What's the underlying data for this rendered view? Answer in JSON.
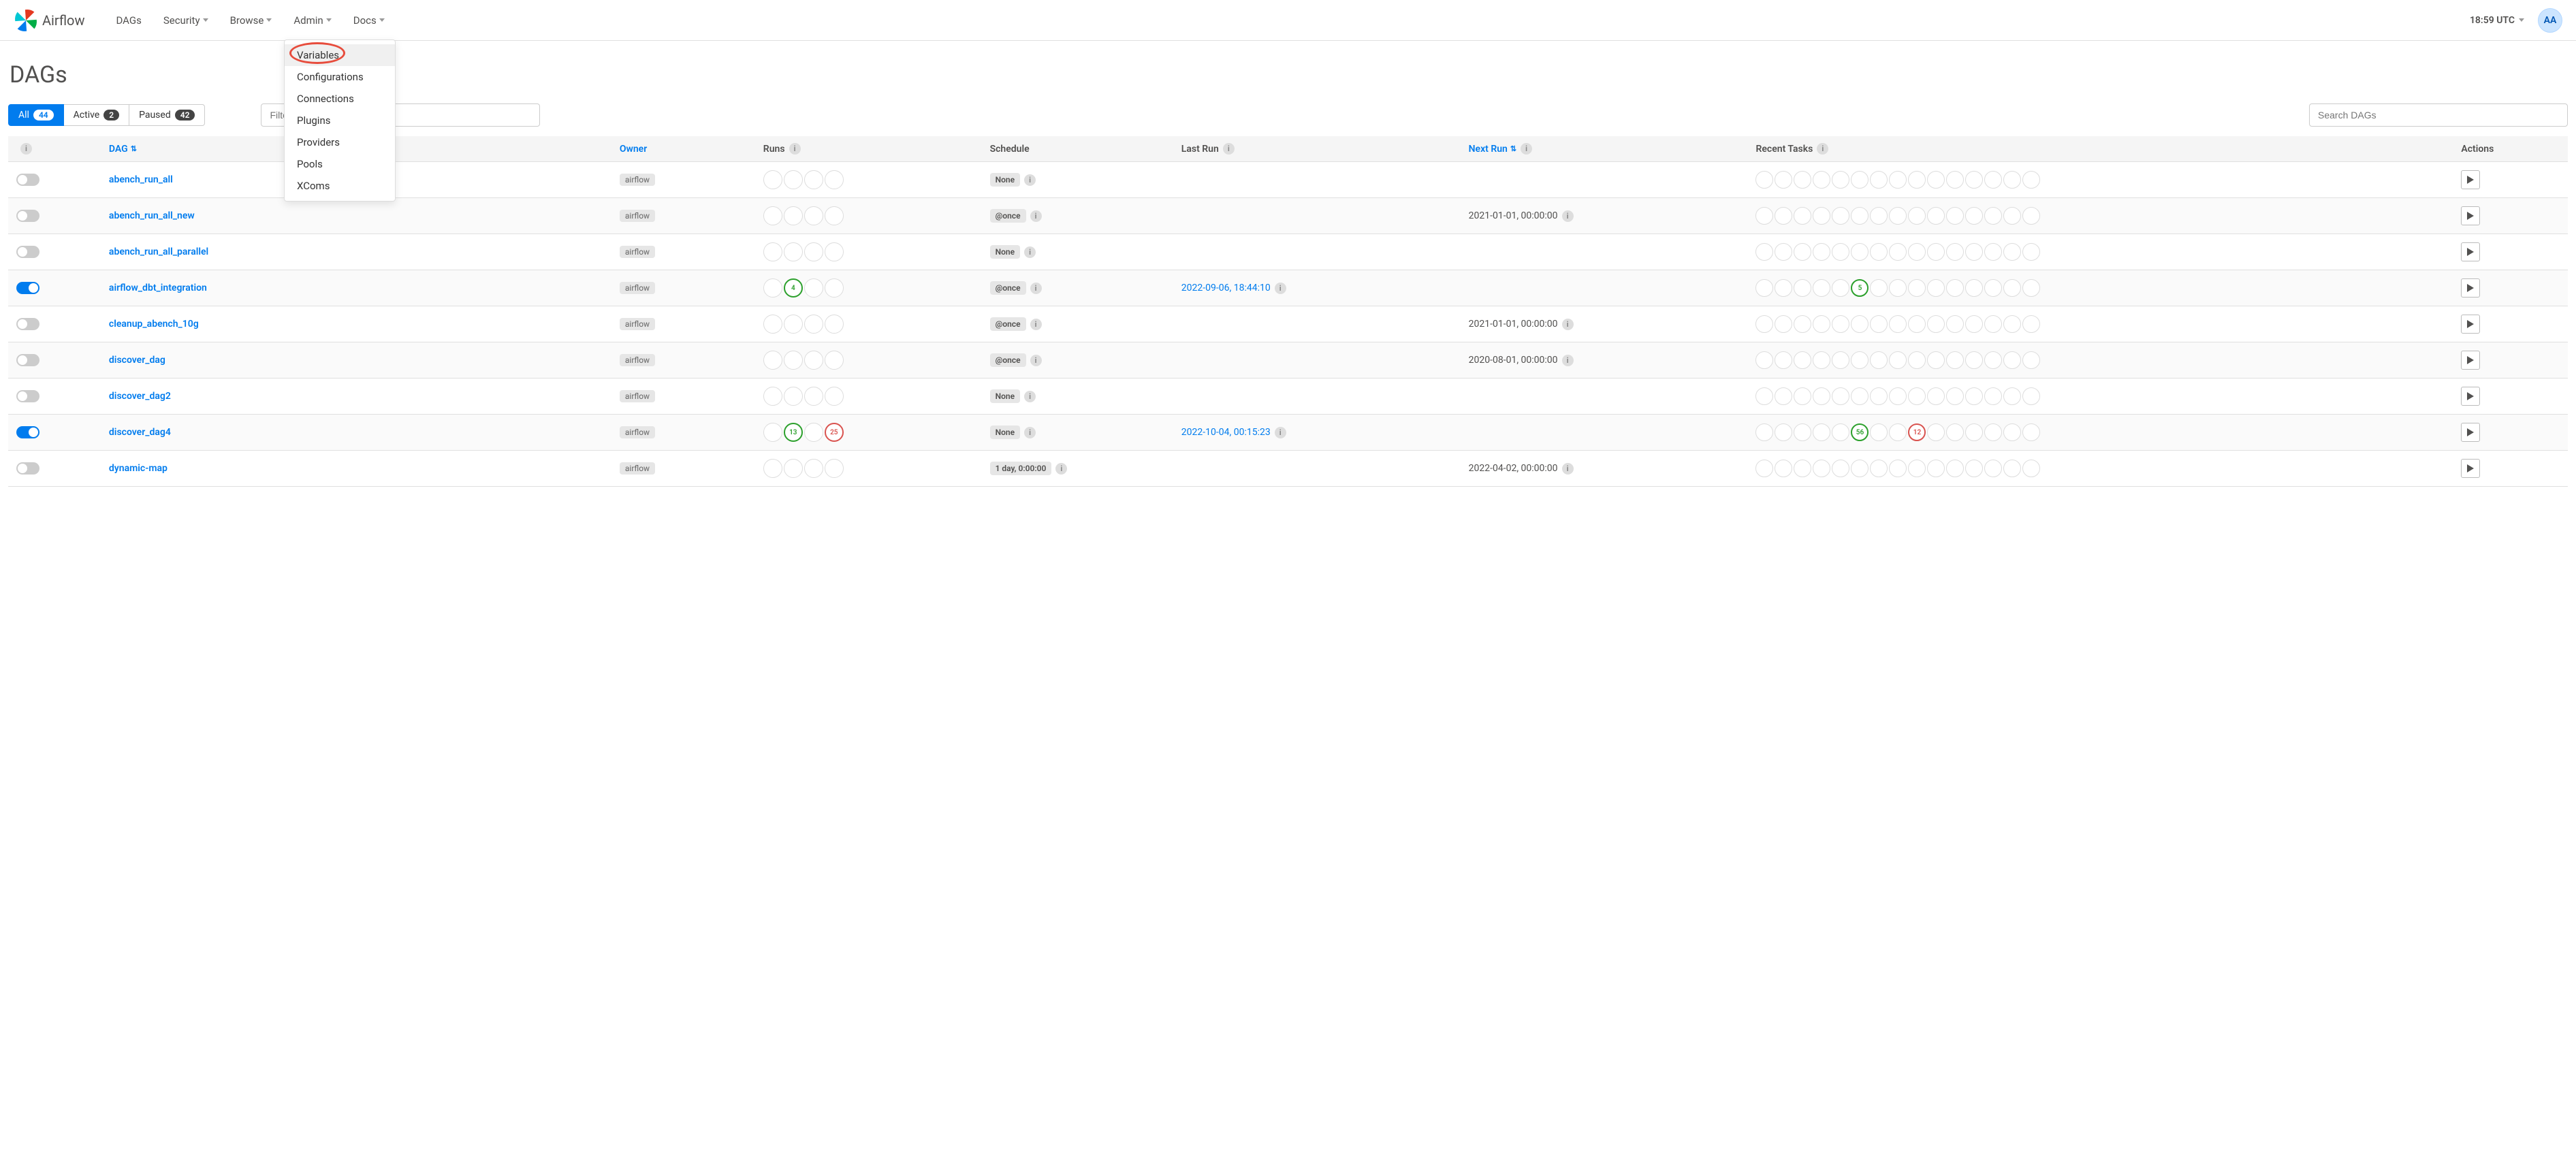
{
  "brand": "Airflow",
  "nav": {
    "dags": "DAGs",
    "security": "Security",
    "browse": "Browse",
    "admin": "Admin",
    "docs": "Docs"
  },
  "clock": "18:59 UTC",
  "user_initials": "AA",
  "admin_menu": {
    "variables": "Variables",
    "configurations": "Configurations",
    "connections": "Connections",
    "plugins": "Plugins",
    "providers": "Providers",
    "pools": "Pools",
    "xcoms": "XComs"
  },
  "page": {
    "title": "DAGs"
  },
  "filters": {
    "all_label": "All",
    "all_count": "44",
    "active_label": "Active",
    "active_count": "2",
    "paused_label": "Paused",
    "paused_count": "42",
    "tag_placeholder": "Filter DAGs by tag",
    "search_placeholder": "Search DAGs"
  },
  "headers": {
    "dag": "DAG",
    "owner": "Owner",
    "runs": "Runs",
    "schedule": "Schedule",
    "last_run": "Last Run",
    "next_run": "Next Run",
    "recent_tasks": "Recent Tasks",
    "actions": "Actions"
  },
  "rows": [
    {
      "on": false,
      "name": "abench_run_all",
      "owner": "airflow",
      "runs": [
        null,
        null,
        null,
        null
      ],
      "schedule": "None",
      "last_run": "",
      "next_run": "",
      "tasks": [
        null,
        null,
        null,
        null,
        null,
        null,
        null,
        null,
        null,
        null,
        null,
        null,
        null,
        null,
        null
      ]
    },
    {
      "on": false,
      "name": "abench_run_all_new",
      "owner": "airflow",
      "runs": [
        null,
        null,
        null,
        null
      ],
      "schedule": "@once",
      "last_run": "",
      "next_run": "2021-01-01, 00:00:00",
      "tasks": [
        null,
        null,
        null,
        null,
        null,
        null,
        null,
        null,
        null,
        null,
        null,
        null,
        null,
        null,
        null
      ]
    },
    {
      "on": false,
      "name": "abench_run_all_parallel",
      "owner": "airflow",
      "runs": [
        null,
        null,
        null,
        null
      ],
      "schedule": "None",
      "last_run": "",
      "next_run": "",
      "tasks": [
        null,
        null,
        null,
        null,
        null,
        null,
        null,
        null,
        null,
        null,
        null,
        null,
        null,
        null,
        null
      ]
    },
    {
      "on": true,
      "name": "airflow_dbt_integration",
      "owner": "airflow",
      "runs": [
        null,
        {
          "v": "4",
          "c": "green"
        },
        null,
        null
      ],
      "schedule": "@once",
      "last_run": "2022-09-06, 18:44:10",
      "next_run": "",
      "tasks": [
        null,
        null,
        null,
        null,
        null,
        {
          "v": "5",
          "c": "green"
        },
        null,
        null,
        null,
        null,
        null,
        null,
        null,
        null,
        null
      ]
    },
    {
      "on": false,
      "name": "cleanup_abench_10g",
      "owner": "airflow",
      "runs": [
        null,
        null,
        null,
        null
      ],
      "schedule": "@once",
      "last_run": "",
      "next_run": "2021-01-01, 00:00:00",
      "tasks": [
        null,
        null,
        null,
        null,
        null,
        null,
        null,
        null,
        null,
        null,
        null,
        null,
        null,
        null,
        null
      ]
    },
    {
      "on": false,
      "name": "discover_dag",
      "owner": "airflow",
      "runs": [
        null,
        null,
        null,
        null
      ],
      "schedule": "@once",
      "last_run": "",
      "next_run": "2020-08-01, 00:00:00",
      "tasks": [
        null,
        null,
        null,
        null,
        null,
        null,
        null,
        null,
        null,
        null,
        null,
        null,
        null,
        null,
        null
      ]
    },
    {
      "on": false,
      "name": "discover_dag2",
      "owner": "airflow",
      "runs": [
        null,
        null,
        null,
        null
      ],
      "schedule": "None",
      "last_run": "",
      "next_run": "",
      "tasks": [
        null,
        null,
        null,
        null,
        null,
        null,
        null,
        null,
        null,
        null,
        null,
        null,
        null,
        null,
        null
      ]
    },
    {
      "on": true,
      "name": "discover_dag4",
      "owner": "airflow",
      "runs": [
        null,
        {
          "v": "13",
          "c": "green"
        },
        null,
        {
          "v": "25",
          "c": "red"
        }
      ],
      "schedule": "None",
      "last_run": "2022-10-04, 00:15:23",
      "next_run": "",
      "tasks": [
        null,
        null,
        null,
        null,
        null,
        {
          "v": "56",
          "c": "green"
        },
        null,
        null,
        {
          "v": "12",
          "c": "red"
        },
        null,
        null,
        null,
        null,
        null,
        null
      ]
    },
    {
      "on": false,
      "name": "dynamic-map",
      "owner": "airflow",
      "runs": [
        null,
        null,
        null,
        null
      ],
      "schedule": "1 day, 0:00:00",
      "last_run": "",
      "next_run": "2022-04-02, 00:00:00",
      "tasks": [
        null,
        null,
        null,
        null,
        null,
        null,
        null,
        null,
        null,
        null,
        null,
        null,
        null,
        null,
        null
      ]
    }
  ]
}
